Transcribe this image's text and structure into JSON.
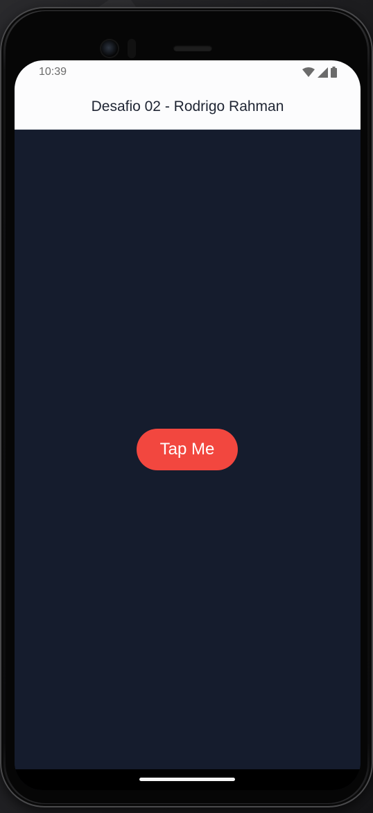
{
  "status_bar": {
    "time": "10:39",
    "icons": [
      "wifi-icon",
      "cellular-signal-icon",
      "battery-icon"
    ]
  },
  "app_bar": {
    "title": "Desafio 02 - Rodrigo Rahman"
  },
  "main": {
    "button_label": "Tap Me"
  },
  "colors": {
    "background": "#151c2d",
    "app_bar": "#fcfcfd",
    "button": "#f2473f",
    "button_text": "#ffffff"
  }
}
